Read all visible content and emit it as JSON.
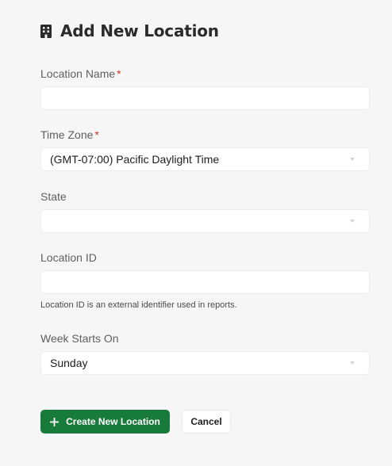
{
  "header": {
    "title": "Add New Location",
    "icon": "building-icon"
  },
  "form": {
    "location_name": {
      "label": "Location Name",
      "required_mark": "*",
      "value": ""
    },
    "time_zone": {
      "label": "Time Zone",
      "required_mark": "*",
      "value": "(GMT-07:00) Pacific Daylight Time"
    },
    "state": {
      "label": "State",
      "value": ""
    },
    "location_id": {
      "label": "Location ID",
      "value": "",
      "hint": "Location ID is an external identifier used in reports."
    },
    "week_starts_on": {
      "label": "Week Starts On",
      "value": "Sunday"
    }
  },
  "actions": {
    "create_label": "Create New Location",
    "create_icon": "plus-icon",
    "cancel_label": "Cancel"
  },
  "colors": {
    "primary": "#187b3b",
    "required": "#d93025",
    "background": "#f6f6f6"
  }
}
